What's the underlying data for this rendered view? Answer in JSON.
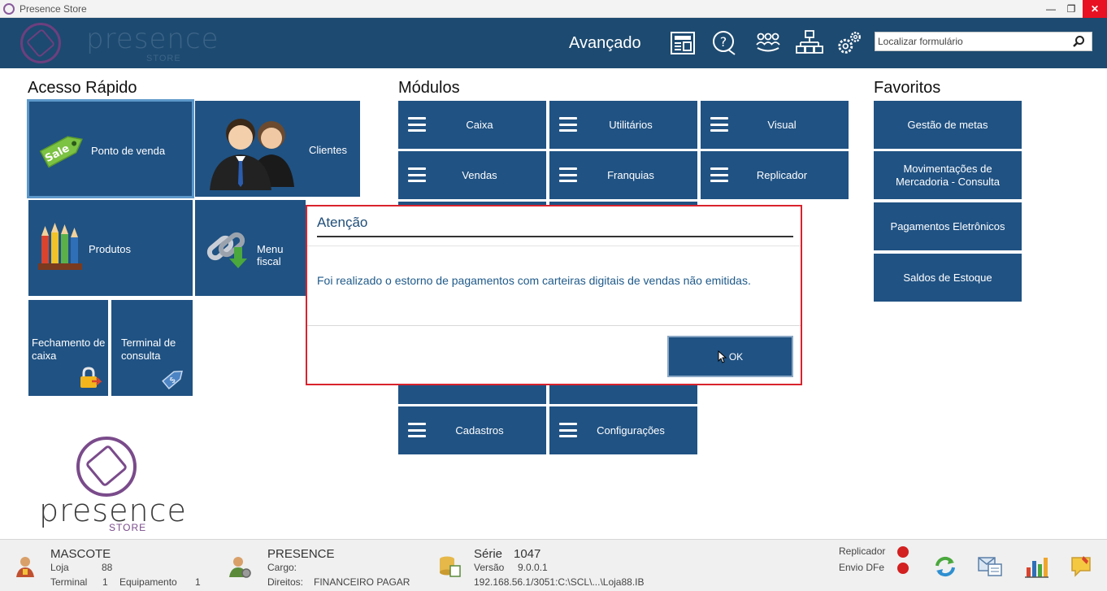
{
  "window": {
    "title": "Presence Store"
  },
  "header": {
    "brand": "presence",
    "brand_sub": "STORE",
    "advanced_label": "Avançado",
    "search_placeholder": "Localizar formulário"
  },
  "quick_access": {
    "title": "Acesso Rápido",
    "tiles": [
      {
        "label": "Ponto de venda",
        "badge": "Sale"
      },
      {
        "label": "Clientes"
      },
      {
        "label": "Produtos"
      },
      {
        "label": "Menu fiscal"
      },
      {
        "label": "Fechamento de caixa"
      },
      {
        "label": "Terminal de consulta"
      }
    ]
  },
  "modules": {
    "title": "Módulos",
    "tiles": [
      {
        "label": "Caixa"
      },
      {
        "label": "Utilitários"
      },
      {
        "label": "Visual"
      },
      {
        "label": "Vendas"
      },
      {
        "label": "Franquias"
      },
      {
        "label": "Replicador"
      },
      {
        "label": "Cadastros"
      },
      {
        "label": "Configurações"
      }
    ]
  },
  "favorites": {
    "title": "Favoritos",
    "tiles": [
      {
        "label": "Gestão de metas"
      },
      {
        "label": "Movimentações de Mercadoria - Consulta"
      },
      {
        "label": "Pagamentos Eletrônicos"
      },
      {
        "label": "Saldos de Estoque"
      }
    ]
  },
  "dialog": {
    "title": "Atenção",
    "message": "Foi realizado o estorno de pagamentos com carteiras digitais de vendas não emitidas.",
    "ok_label": "OK"
  },
  "logo": {
    "brand": "presence",
    "sub": "STORE"
  },
  "statusbar": {
    "user": {
      "name": "MASCOTE",
      "store_label": "Loja",
      "store_value": "88",
      "terminal_label": "Terminal",
      "terminal_value": "1",
      "equip_label": "Equipamento",
      "equip_value": "1"
    },
    "company": {
      "name": "PRESENCE",
      "role_label": "Cargo:",
      "rights_label": "Direitos:",
      "rights_value": "FINANCEIRO PAGAR"
    },
    "system": {
      "series_label": "Série",
      "series_value": "1047",
      "version_label": "Versão",
      "version_value": "9.0.0.1",
      "connection": "192.168.56.1/3051:C:\\SCL\\...\\Loja88.IB"
    },
    "services": {
      "replicator": "Replicador",
      "dfe": "Envio DFe"
    }
  },
  "colors": {
    "tile": "#205283",
    "header": "#1d4a70",
    "dialog_border": "#d9232d",
    "brand_purple": "#7a4b8b"
  }
}
